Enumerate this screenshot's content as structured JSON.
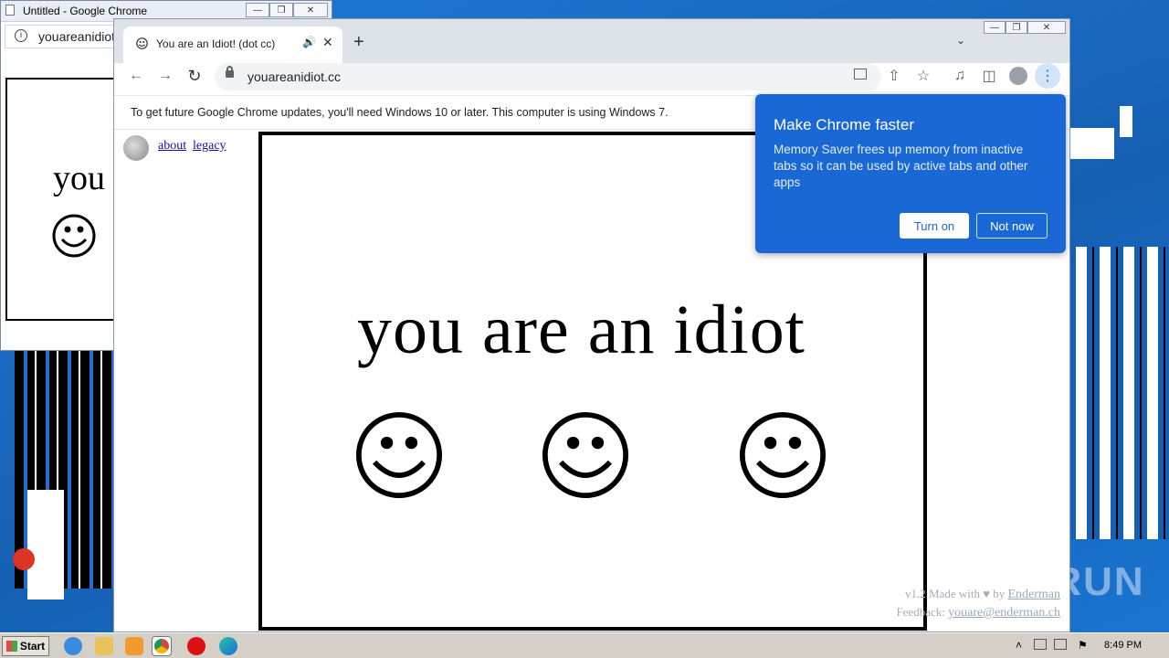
{
  "bg_window": {
    "title": "Untitled - Google Chrome",
    "url": "youareanidiot.cc",
    "page_text": "you"
  },
  "main_window": {
    "tab_title": "You are an Idiot! (dot cc)",
    "url": "youareanidiot.cc",
    "infobar_text": "To get future Google Chrome updates, you'll need Windows 10 or later. This computer is using Windows 7.",
    "links": {
      "about": "about",
      "legacy": "legacy"
    },
    "headline": "you are an idiot",
    "footer": {
      "version": "v1.2",
      "made_with": "Made with",
      "by": "by",
      "author": "Enderman",
      "feedback_label": "Feedback:",
      "feedback_email": "youare@enderman.ch"
    }
  },
  "popup": {
    "title": "Make Chrome faster",
    "body": "Memory Saver frees up memory from inactive tabs so it can be used by active tabs and other apps",
    "turn_on": "Turn on",
    "not_now": "Not now",
    "bg_color": "#1a68d6"
  },
  "taskbar": {
    "start_label": "Start",
    "clock": "8:49 PM"
  },
  "watermark": "ANY RUN"
}
